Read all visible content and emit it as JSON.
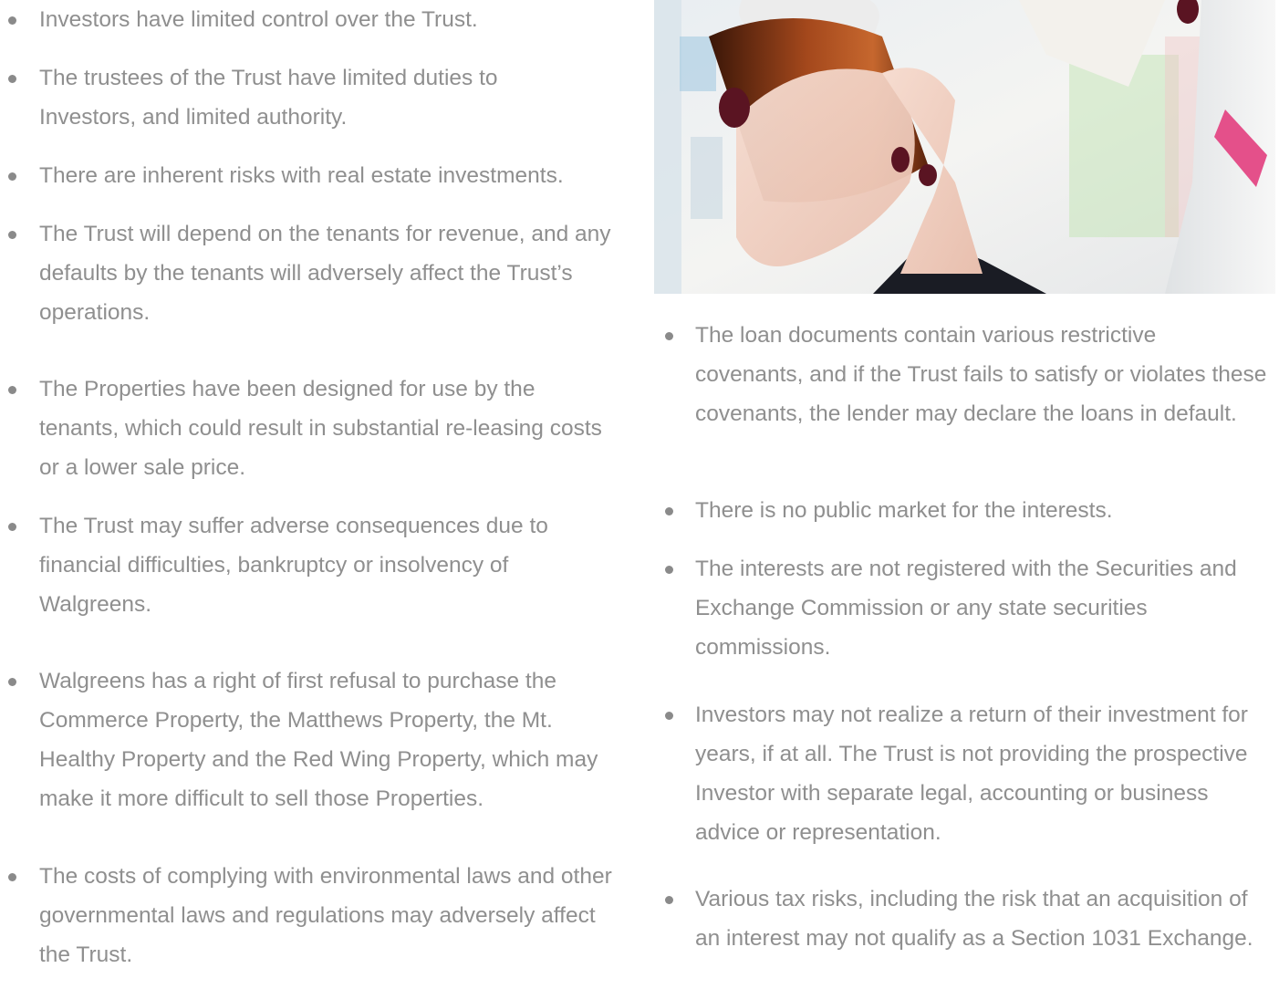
{
  "left_column": {
    "items": [
      "Investors have limited control over the Trust.",
      "The trustees of the Trust have limited duties to Investors, and limited authority.",
      "There are inherent risks with real estate investments.",
      "The Trust will depend on the tenants for revenue, and any defaults by the tenants will adversely affect the Trust’s operations.",
      "The Properties have been designed for use by the tenants, which could result in substantial re-leasing costs or a lower sale price.",
      "The Trust may suffer adverse consequences due to financial difficulties, bankruptcy or insolvency of Walgreens.",
      "Walgreens has a right of first refusal to purchase the Commerce Property, the Matthews Property, the Mt. Healthy Property and the Red Wing Property, which may make it more difficult to sell those Properties.",
      "The costs of complying with environmental laws and other governmental laws and regulations may adversely affect the Trust."
    ]
  },
  "right_column": {
    "photo_icon": "pharmacy-photo",
    "items": [
      "The loan documents contain various restrictive covenants, and if the Trust fails to satisfy or violates these covenants, the lender may declare the loans in default.",
      "There is no public market for the interests.",
      "The interests are not registered with the Securities and Exchange Commission or any state securities commissions.",
      "Investors may not realize a return of their investment for years, if at all. The Trust is not providing the prospective Investor with separate legal, accounting or business advice or representation.",
      "Various tax risks, including the risk that an acquisition of an interest may not qualify as a Section 1031 Exchange."
    ]
  },
  "colors": {
    "text": "#8f8f8f",
    "bullet": "#8a8a8a"
  }
}
